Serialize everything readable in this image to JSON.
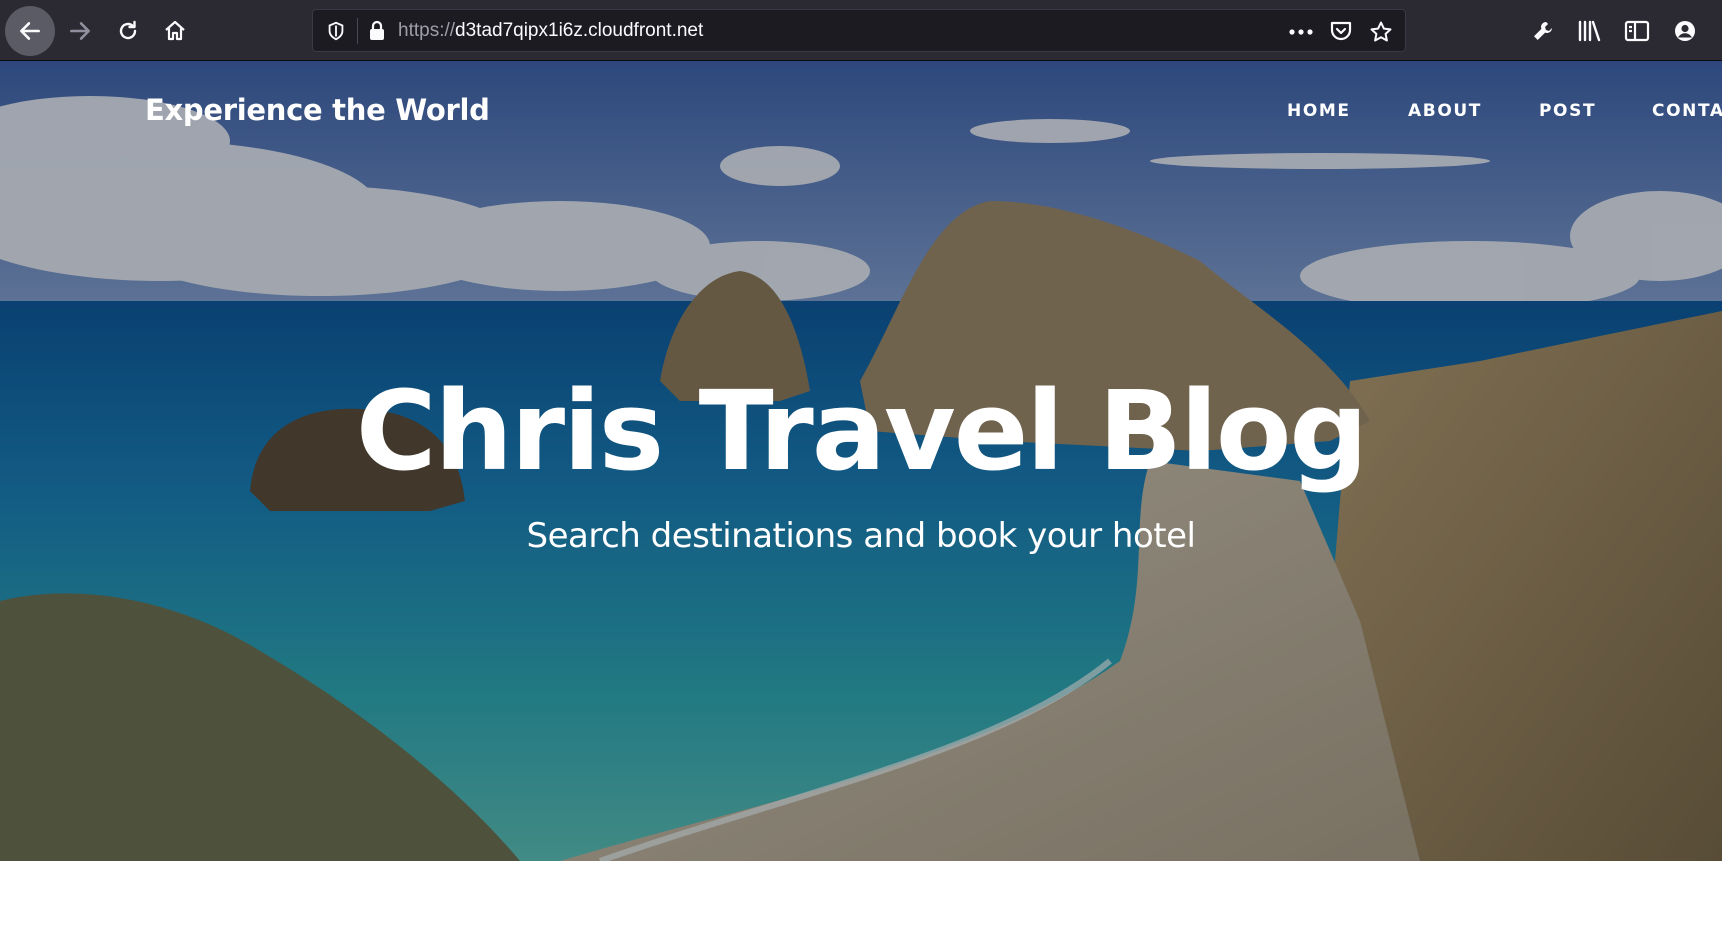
{
  "browser": {
    "url_scheme": "https://",
    "url_host": "d3tad7qipx1i6z.cloudfront.net",
    "icons": {
      "back": "back-arrow-icon",
      "forward": "forward-arrow-icon",
      "reload": "reload-icon",
      "home": "home-icon",
      "tracking": "shield-icon",
      "lock": "lock-icon",
      "page_actions": "more-dots-icon",
      "pocket": "pocket-icon",
      "bookmark": "star-icon",
      "tools": "wrench-icon",
      "library": "library-icon",
      "sidebar": "sidebar-icon",
      "account": "account-icon"
    }
  },
  "site": {
    "brand": "Experience the World",
    "nav": [
      "HOME",
      "ABOUT",
      "POST",
      "CONTA"
    ],
    "title": "Chris Travel Blog",
    "subtitle": "Search destinations and book your hotel"
  },
  "colors": {
    "toolbar_bg": "#2b2a33",
    "urlbar_bg": "#1c1b22",
    "text_on_hero": "#ffffff"
  }
}
